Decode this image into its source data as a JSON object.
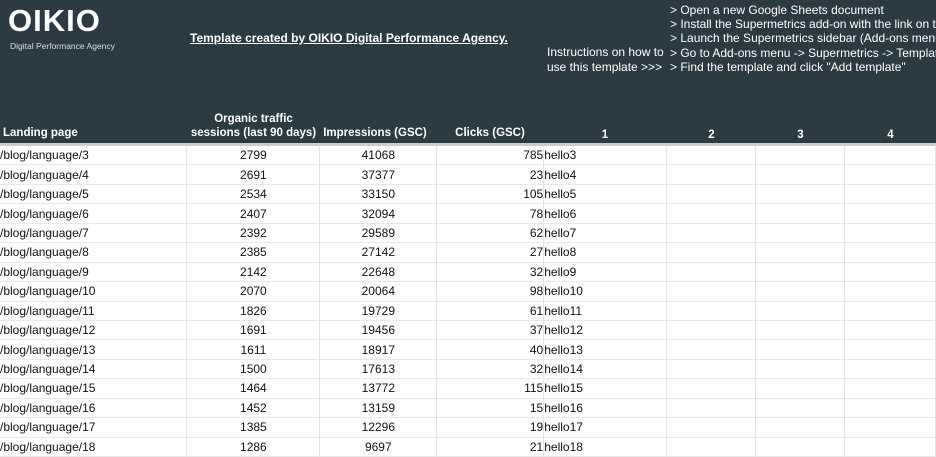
{
  "header": {
    "logo_text": "OIKIO",
    "tagline": "Digital Performance Agency",
    "credit": "Template created by OIKIO Digital Performance Agency.",
    "instructions_label_line1": "Instructions on how to",
    "instructions_label_line2": "use this template  >>>",
    "steps": [
      "> Open a new Google Sheets document",
      "> Install the Supermetrics add-on with the link on th",
      "> Launch the Supermetrics sidebar (Add-ons menu",
      "> Go to Add-ons menu -> Supermetrics -> Template",
      "> Find the template and click \"Add template\""
    ]
  },
  "columns": {
    "landing": "Landing page",
    "organic_line1": "Organic traffic",
    "organic_line2": "sessions (last 90 days)",
    "impressions": "Impressions (GSC)",
    "clicks": "Clicks (GSC)",
    "c1": "1",
    "c2": "2",
    "c3": "3",
    "c4": "4"
  },
  "rows": [
    {
      "landing": "/blog/language/3",
      "organic": "2799",
      "impressions": "41068",
      "clicks": "785",
      "kw": "hello3"
    },
    {
      "landing": "/blog/language/4",
      "organic": "2691",
      "impressions": "37377",
      "clicks": "23",
      "kw": "hello4"
    },
    {
      "landing": "/blog/language/5",
      "organic": "2534",
      "impressions": "33150",
      "clicks": "105",
      "kw": "hello5"
    },
    {
      "landing": "/blog/language/6",
      "organic": "2407",
      "impressions": "32094",
      "clicks": "78",
      "kw": "hello6"
    },
    {
      "landing": "/blog/language/7",
      "organic": "2392",
      "impressions": "29589",
      "clicks": "62",
      "kw": "hello7"
    },
    {
      "landing": "/blog/language/8",
      "organic": "2385",
      "impressions": "27142",
      "clicks": "27",
      "kw": "hello8"
    },
    {
      "landing": "/blog/language/9",
      "organic": "2142",
      "impressions": "22648",
      "clicks": "32",
      "kw": "hello9"
    },
    {
      "landing": "/blog/language/10",
      "organic": "2070",
      "impressions": "20064",
      "clicks": "98",
      "kw": "hello10"
    },
    {
      "landing": "/blog/language/11",
      "organic": "1826",
      "impressions": "19729",
      "clicks": "61",
      "kw": "hello11"
    },
    {
      "landing": "/blog/language/12",
      "organic": "1691",
      "impressions": "19456",
      "clicks": "37",
      "kw": "hello12"
    },
    {
      "landing": "/blog/language/13",
      "organic": "1611",
      "impressions": "18917",
      "clicks": "40",
      "kw": "hello13"
    },
    {
      "landing": "/blog/language/14",
      "organic": "1500",
      "impressions": "17613",
      "clicks": "32",
      "kw": "hello14"
    },
    {
      "landing": "/blog/language/15",
      "organic": "1464",
      "impressions": "13772",
      "clicks": "115",
      "kw": "hello15"
    },
    {
      "landing": "/blog/language/16",
      "organic": "1452",
      "impressions": "13159",
      "clicks": "15",
      "kw": "hello16"
    },
    {
      "landing": "/blog/language/17",
      "organic": "1385",
      "impressions": "12296",
      "clicks": "19",
      "kw": "hello17"
    },
    {
      "landing": "/blog/language/18",
      "organic": "1286",
      "impressions": "9697",
      "clicks": "21",
      "kw": "hello18"
    }
  ]
}
